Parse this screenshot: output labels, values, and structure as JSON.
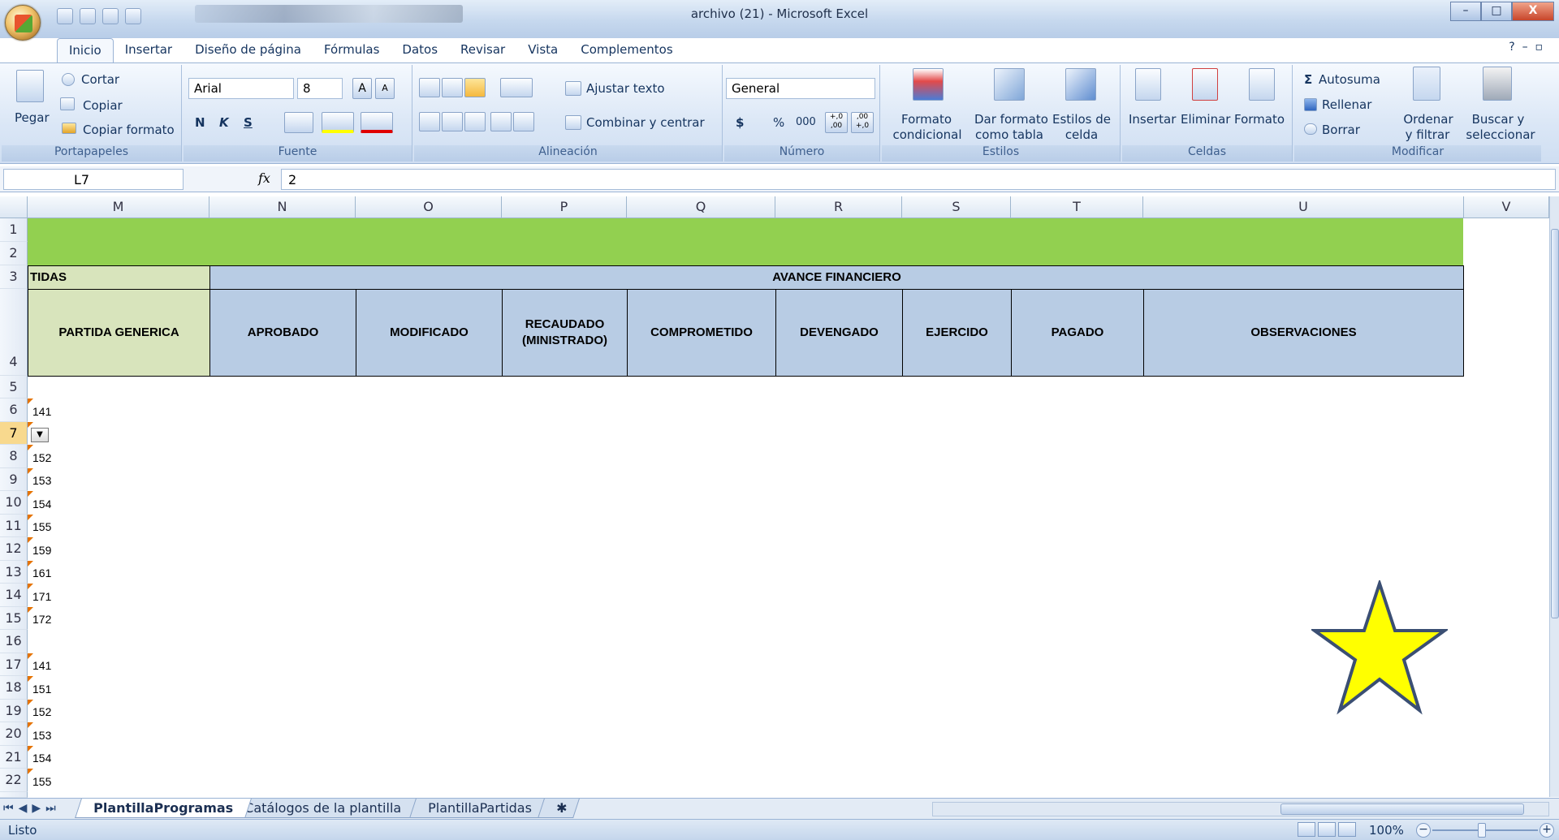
{
  "window": {
    "title": "archivo (21) - Microsoft Excel",
    "controls": [
      "–",
      "□",
      "X"
    ]
  },
  "tabs": [
    "Inicio",
    "Insertar",
    "Diseño de página",
    "Fórmulas",
    "Datos",
    "Revisar",
    "Vista",
    "Complementos"
  ],
  "ribbon": {
    "clipboard": {
      "paste": "Pegar",
      "cut": "Cortar",
      "copy": "Copiar",
      "format_painter": "Copiar formato",
      "label": "Portapapeles"
    },
    "font": {
      "name": "Arial",
      "size": "8",
      "bold": "N",
      "italic": "K",
      "underline": "S",
      "label": "Fuente"
    },
    "alignment": {
      "wrap": "Ajustar texto",
      "merge": "Combinar y centrar",
      "label": "Alineación"
    },
    "number": {
      "format": "General",
      "currency": "$",
      "percent": "%",
      "thousands": "000",
      "inc_decimals": "+,0 ,00",
      "dec_decimals": ",00 +,0",
      "label": "Número"
    },
    "styles": {
      "conditional_1": "Formato",
      "conditional_2": "condicional",
      "table_1": "Dar formato",
      "table_2": "como tabla",
      "cell_1": "Estilos de",
      "cell_2": "celda",
      "label": "Estilos"
    },
    "cells": {
      "insert": "Insertar",
      "delete": "Eliminar",
      "format": "Formato",
      "label": "Celdas"
    },
    "editing": {
      "autosum": "Autosuma",
      "fill": "Rellenar",
      "clear": "Borrar",
      "sort_1": "Ordenar",
      "sort_2": "y filtrar",
      "find_1": "Buscar y",
      "find_2": "seleccionar",
      "label": "Modificar"
    }
  },
  "formula_bar": {
    "name_box": "L7",
    "fx": "fx",
    "value": "2"
  },
  "columns": [
    "M",
    "N",
    "O",
    "P",
    "Q",
    "R",
    "S",
    "T",
    "U",
    "V"
  ],
  "rows": [
    "1",
    "2",
    "3",
    "4",
    "5",
    "6",
    "7",
    "8",
    "9",
    "10",
    "11",
    "12",
    "13",
    "14",
    "15",
    "16",
    "17",
    "18",
    "19",
    "20",
    "21",
    "22"
  ],
  "sheet": {
    "partidas_header": "TIDAS",
    "avance_header": "AVANCE FINANCIERO",
    "headers": [
      "PARTIDA GENERICA",
      "APROBADO",
      "MODIFICADO",
      "RECAUDADO (MINISTRADO)",
      "COMPROMETIDO",
      "DEVENGADO",
      "EJERCIDO",
      "PAGADO",
      "OBSERVACIONES"
    ],
    "values": {
      "6": "141",
      "8": "152",
      "9": "153",
      "10": "154",
      "11": "155",
      "12": "159",
      "13": "161",
      "14": "171",
      "15": "172",
      "17": "141",
      "18": "151",
      "19": "152",
      "20": "153",
      "21": "154",
      "22": "155"
    }
  },
  "sheet_tabs": [
    "PlantillaProgramas",
    "Catálogos de la plantilla",
    "PlantillaPartidas"
  ],
  "status": {
    "ready": "Listo",
    "zoom": "100%"
  },
  "colors": {
    "green_band": "#92d050",
    "header_blue": "#b8cce4",
    "header_green": "#d8e4bc",
    "star_fill": "#ffff00",
    "star_stroke": "#3b4f73"
  },
  "icons": [
    "office-button-icon",
    "save-icon",
    "undo-icon",
    "redo-icon",
    "print-preview-icon",
    "paste-icon",
    "cut-icon",
    "copy-icon",
    "format-painter-icon",
    "star-shape"
  ]
}
